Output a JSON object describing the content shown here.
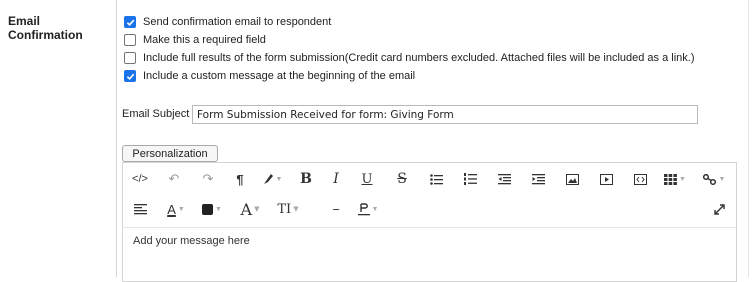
{
  "section": {
    "label": "Email Confirmation"
  },
  "options": [
    {
      "label": "Send confirmation email to respondent",
      "checked": true
    },
    {
      "label": "Make this a required field",
      "checked": false
    },
    {
      "label": "Include full results of the form submission(Credit card numbers excluded. Attached files will be included as a link.)",
      "checked": false
    },
    {
      "label": "Include a custom message at the beginning of the email",
      "checked": true
    }
  ],
  "subject": {
    "label": "Email Subject",
    "value": "Form Submission Received for form: Giving Form"
  },
  "personalization": {
    "label": "Personalization"
  },
  "toolbar": {
    "code_view": "</>",
    "undo": "↶",
    "redo": "↷",
    "paragraph": "¶",
    "bold": "B",
    "italic": "I",
    "underline": "U",
    "strikethrough": "S",
    "font_color": "A",
    "font_size": "A",
    "text_transform": "TI",
    "hr": "−"
  },
  "editor": {
    "placeholder": "Add your message here"
  },
  "colors": {
    "checkbox_accent": "#1a73e8"
  }
}
